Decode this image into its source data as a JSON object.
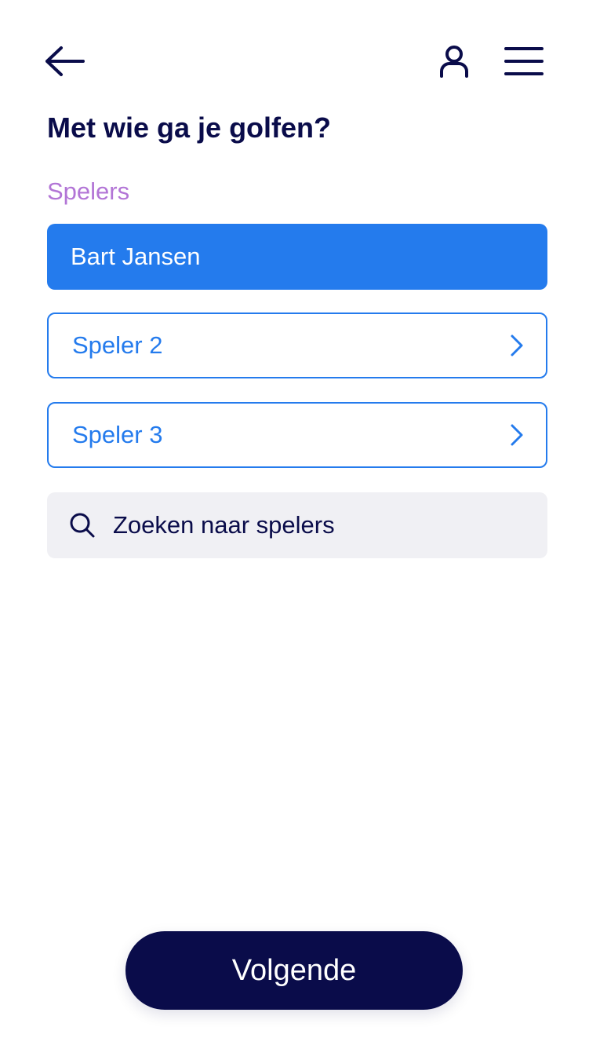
{
  "header": {
    "back_icon": "arrow-left-icon",
    "account_icon": "user-icon",
    "menu_icon": "hamburger-menu-icon"
  },
  "main": {
    "title": "Met wie ga je golfen?",
    "section_label": "Spelers",
    "players": [
      {
        "label": "Bart Jansen",
        "state": "selected"
      },
      {
        "label": "Speler 2",
        "state": "empty"
      },
      {
        "label": "Speler 3",
        "state": "empty"
      }
    ],
    "search": {
      "placeholder": "Zoeken naar spelers",
      "icon": "search-icon"
    }
  },
  "footer": {
    "next_label": "Volgende"
  },
  "colors": {
    "navy": "#0a0c4a",
    "accent_blue": "#247bed",
    "label_purple": "#b275d6",
    "search_bg": "#f0f0f4"
  }
}
